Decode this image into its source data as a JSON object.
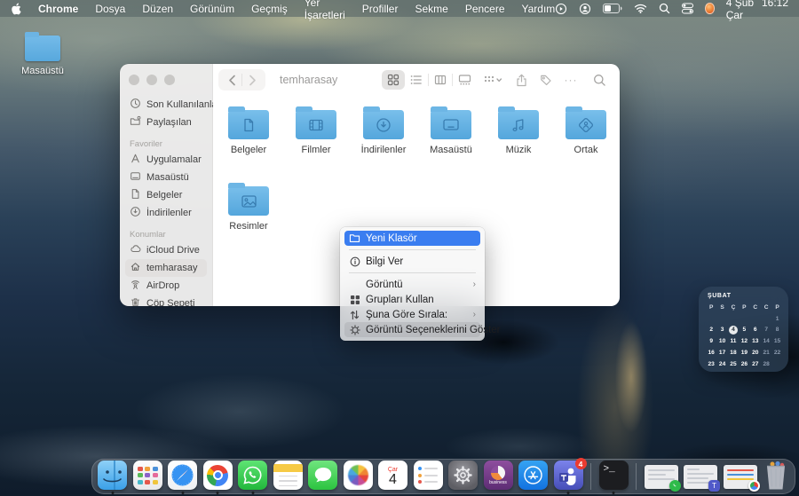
{
  "menu_bar": {
    "app_name": "Chrome",
    "menus": [
      "Dosya",
      "Düzen",
      "Görünüm",
      "Geçmiş",
      "Yer İşaretleri",
      "Profiller",
      "Sekme",
      "Pencere",
      "Yardım"
    ],
    "status_icons": [
      "screen-record-icon",
      "user-circle-icon",
      "battery-icon",
      "wifi-icon",
      "search-icon",
      "control-center-icon",
      "profile-avatar"
    ],
    "date": "4 Şub Çar",
    "time": "16:12"
  },
  "desktop": {
    "icon_label": "Masaüstü"
  },
  "finder": {
    "title": "temharasay",
    "toolbar": {
      "more_label": "···"
    },
    "sidebar": {
      "top_items": [
        {
          "label": "Son Kullanılanlar",
          "icon": "clock-icon"
        },
        {
          "label": "Paylaşılan",
          "icon": "shared-folder-icon"
        }
      ],
      "sections": [
        {
          "header": "Favoriler",
          "items": [
            {
              "label": "Uygulamalar",
              "icon": "applications-icon"
            },
            {
              "label": "Masaüstü",
              "icon": "desktop-icon"
            },
            {
              "label": "Belgeler",
              "icon": "document-icon"
            },
            {
              "label": "İndirilenler",
              "icon": "download-icon"
            }
          ]
        },
        {
          "header": "Konumlar",
          "items": [
            {
              "label": "iCloud Drive",
              "icon": "cloud-icon"
            },
            {
              "label": "temharasay",
              "icon": "home-icon",
              "selected": true
            },
            {
              "label": "AirDrop",
              "icon": "airdrop-icon"
            },
            {
              "label": "Çöp Sepeti",
              "icon": "trash-icon"
            }
          ]
        }
      ]
    },
    "folders": [
      {
        "label": "Belgeler",
        "glyph": "document-glyph-icon"
      },
      {
        "label": "Filmler",
        "glyph": "film-glyph-icon"
      },
      {
        "label": "İndirilenler",
        "glyph": "download-glyph-icon"
      },
      {
        "label": "Masaüstü",
        "glyph": "desktop-glyph-icon"
      },
      {
        "label": "Müzik",
        "glyph": "music-glyph-icon"
      },
      {
        "label": "Ortak",
        "glyph": "shared-glyph-icon"
      },
      {
        "label": "Resimler",
        "glyph": "picture-glyph-icon"
      }
    ]
  },
  "context_menu": {
    "items": [
      {
        "label": "Yeni Klasör",
        "icon": "new-folder-icon",
        "highlighted": true
      },
      {
        "label": "Bilgi Ver",
        "icon": "info-icon"
      },
      {
        "label": "Görüntü",
        "submenu": "›"
      },
      {
        "label": "Grupları Kullan",
        "icon": "use-groups-icon"
      },
      {
        "label": "Şuna Göre Sırala:",
        "icon": "sort-icon",
        "submenu": "›"
      },
      {
        "label": "Görüntü Seçeneklerini Göster",
        "icon": "view-options-icon"
      }
    ]
  },
  "calendar": {
    "month": "ŞUBAT",
    "day_headers": [
      "P",
      "S",
      "Ç",
      "P",
      "C",
      "C",
      "P"
    ],
    "weeks": [
      [
        "",
        "",
        "",
        "",
        "",
        "",
        "1"
      ],
      [
        "2",
        "3",
        "4",
        "5",
        "6",
        "7",
        "8"
      ],
      [
        "9",
        "10",
        "11",
        "12",
        "13",
        "14",
        "15"
      ],
      [
        "16",
        "17",
        "18",
        "19",
        "20",
        "21",
        "22"
      ],
      [
        "23",
        "24",
        "25",
        "26",
        "27",
        "28",
        ""
      ]
    ],
    "selected_day": "4"
  },
  "dock": {
    "apps": [
      "finder",
      "launchpad",
      "safari",
      "chrome",
      "whatsapp",
      "notes",
      "messages",
      "photos",
      "calendar",
      "reminders",
      "settings",
      "splashtop-business",
      "app-store",
      "teams",
      "terminal"
    ],
    "running": [
      "finder",
      "safari",
      "chrome",
      "whatsapp",
      "teams",
      "terminal"
    ],
    "calendar_weekday": "Çar",
    "calendar_day": "4",
    "splashtop_label": "business",
    "appstore_glyph": "A",
    "teams_badge": "4",
    "teams_glyph": "T",
    "terminal_glyph": ">_",
    "minimized_windows": [
      "whatsapp-window",
      "teams-window",
      "chrome-window"
    ]
  }
}
